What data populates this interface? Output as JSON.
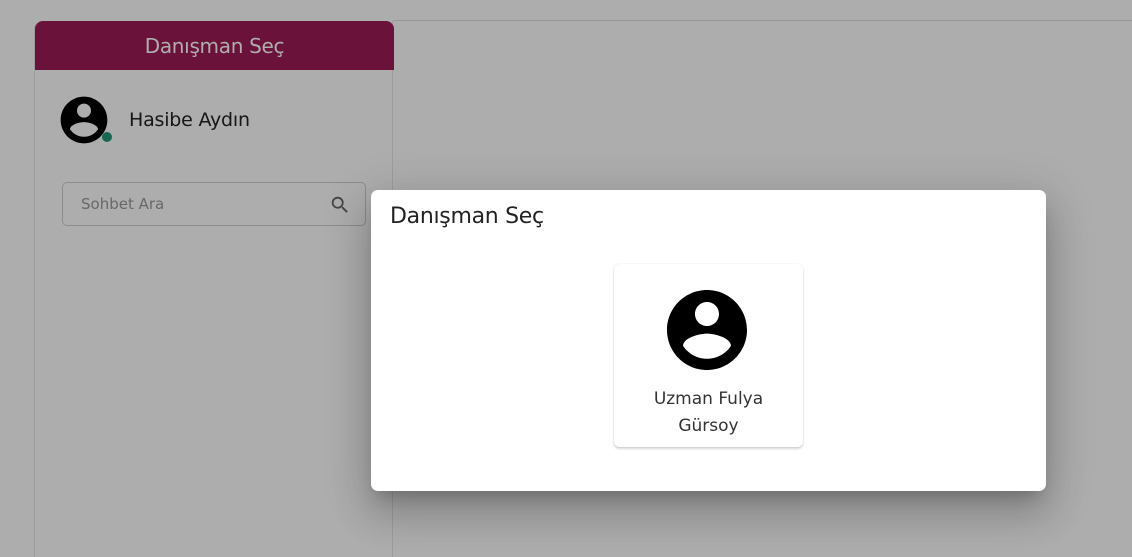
{
  "sidebar": {
    "select_button_label": "Danışman Seç",
    "user": {
      "name": "Hasibe Aydın",
      "avatar_icon": "account-circle-icon",
      "status": "online"
    },
    "search": {
      "placeholder": "Sohbet Ara",
      "value": "",
      "icon": "search-icon"
    }
  },
  "dialog": {
    "title": "Danışman Seç",
    "consultants": [
      {
        "name": "Uzman Fulya Gürsoy",
        "avatar_icon": "account-circle-icon"
      }
    ]
  },
  "colors": {
    "accent": "#9c1b55",
    "online": "#1f9b7a",
    "overlay": "rgba(0,0,0,0.32)"
  }
}
